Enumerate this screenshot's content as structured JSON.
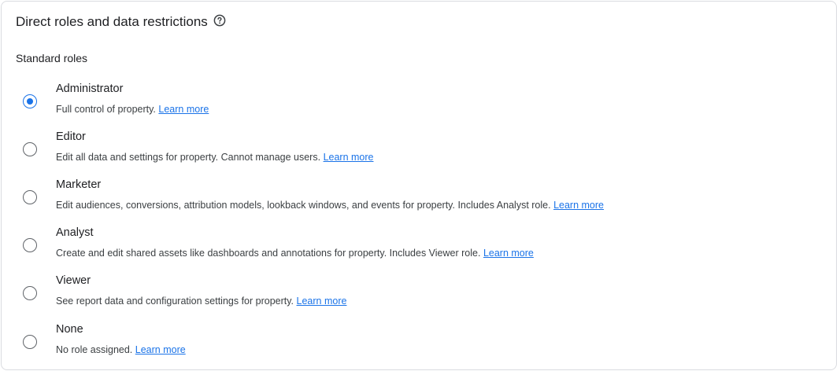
{
  "card": {
    "title": "Direct roles and data restrictions",
    "help_icon": "help-circle-icon"
  },
  "section": {
    "label": "Standard roles"
  },
  "roles": [
    {
      "name": "Administrator",
      "description": "Full control of property.",
      "link": "Learn more",
      "selected": true
    },
    {
      "name": "Editor",
      "description": "Edit all data and settings for property. Cannot manage users.",
      "link": "Learn more",
      "selected": false
    },
    {
      "name": "Marketer",
      "description": "Edit audiences, conversions, attribution models, lookback windows, and events for property. Includes Analyst role.",
      "link": "Learn more",
      "selected": false
    },
    {
      "name": "Analyst",
      "description": "Create and edit shared assets like dashboards and annotations for property. Includes Viewer role.",
      "link": "Learn more",
      "selected": false
    },
    {
      "name": "Viewer",
      "description": "See report data and configuration settings for property.",
      "link": "Learn more",
      "selected": false
    },
    {
      "name": "None",
      "description": "No role assigned.",
      "link": "Learn more",
      "selected": false
    }
  ],
  "colors": {
    "accent": "#1a73e8",
    "border": "#dadce0",
    "text": "#202124"
  }
}
